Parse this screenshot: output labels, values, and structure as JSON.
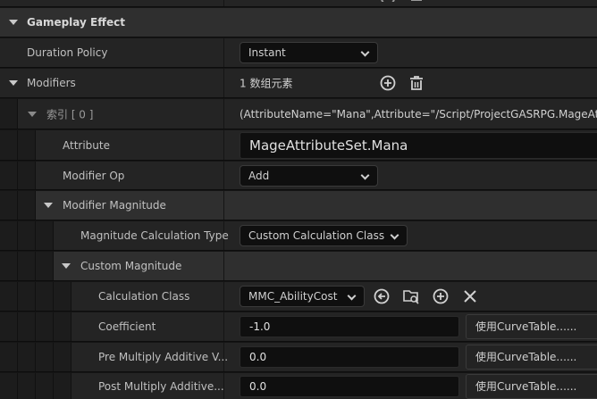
{
  "category": {
    "title": "Gameplay Effect"
  },
  "duration_policy": {
    "label": "Duration Policy",
    "value": "Instant"
  },
  "modifiers": {
    "label": "Modifiers",
    "count_text": "1 数组元素"
  },
  "element": {
    "index_label": "索引 [ 0 ]",
    "summary": "(AttributeName=\"Mana\",Attribute=\"/Script/ProjectGASRPG.MageAttrib"
  },
  "attribute": {
    "label": "Attribute",
    "value": "MageAttributeSet.Mana"
  },
  "modifier_op": {
    "label": "Modifier Op",
    "value": "Add"
  },
  "modifier_magnitude": {
    "label": "Modifier Magnitude"
  },
  "magnitude_calc_type": {
    "label": "Magnitude Calculation Type",
    "value": "Custom Calculation Class"
  },
  "custom_magnitude": {
    "label": "Custom Magnitude"
  },
  "calculation_class": {
    "label": "Calculation Class",
    "value": "MMC_AbilityCost"
  },
  "coefficient": {
    "label": "Coefficient",
    "value": "-1.0",
    "curve_button": "使用CurveTable......"
  },
  "pre_multiply": {
    "label": "Pre Multiply Additive V...",
    "value": "0.0",
    "curve_button": "使用CurveTable......"
  },
  "post_multiply": {
    "label": "Post Multiply Additive...",
    "value": "0.0",
    "curve_button": "使用CurveTable......"
  },
  "colors": {
    "panel_bg": "#242424",
    "category_bg": "#2f2f2f",
    "field_bg": "#0f0f0f",
    "text": "#c0c0c0"
  }
}
